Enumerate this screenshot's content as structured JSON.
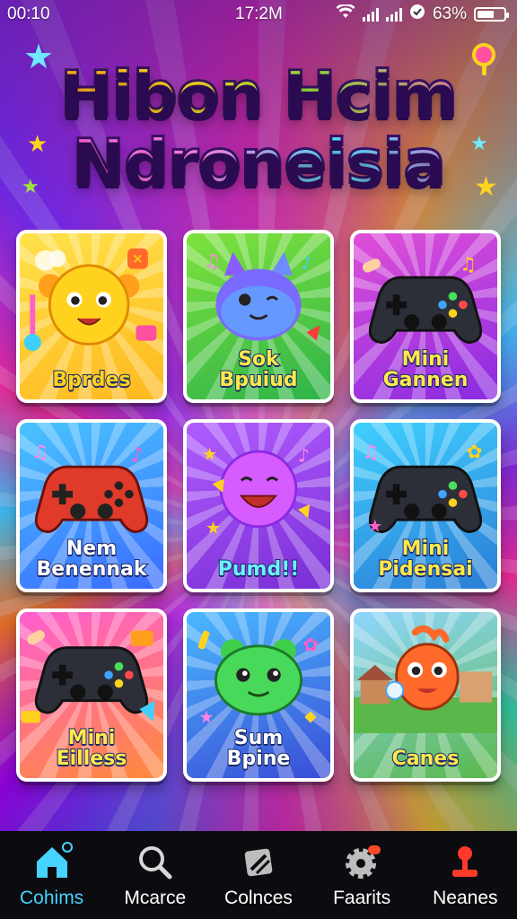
{
  "status_bar": {
    "time_left": "00:10",
    "time_center": "17:2M",
    "battery": "63%",
    "battery_level": 0.63
  },
  "title": {
    "line1": "Hibon Hcim",
    "line2": "Ndroneisia"
  },
  "games": [
    {
      "label_line1": "Bprdes",
      "label_line2": "",
      "art": "yellow-bear-character",
      "bg": [
        "#ffe24a",
        "#ffb81e"
      ],
      "label_color": "#ffd21e"
    },
    {
      "label_line1": "Sok",
      "label_line2": "Bpuiud",
      "art": "purple-cat-character",
      "bg": [
        "#7ee23c",
        "#2fb34a"
      ],
      "label_color": "#ffe94a"
    },
    {
      "label_line1": "Mini",
      "label_line2": "Gannen",
      "art": "gamepad-black",
      "bg": [
        "#e04fd8",
        "#8a2be2"
      ],
      "label_color": "#ffe94a"
    },
    {
      "label_line1": "Nem",
      "label_line2": "Benennak",
      "art": "gamepad-red",
      "bg": [
        "#49c4ff",
        "#3a6bff"
      ],
      "label_color": "#ffffff"
    },
    {
      "label_line1": "Pumd!!",
      "label_line2": "",
      "art": "purple-blob-character",
      "bg": [
        "#b05cff",
        "#7a2ed6"
      ],
      "label_color": "#6ff0ff"
    },
    {
      "label_line1": "Mini",
      "label_line2": "Pidensai",
      "art": "gamepad-black",
      "bg": [
        "#3fd0ff",
        "#2a7dd6"
      ],
      "label_color": "#ffe94a"
    },
    {
      "label_line1": "Mini",
      "label_line2": "Eilless",
      "art": "gamepad-black",
      "bg": [
        "#ff5ecf",
        "#ff8a3a"
      ],
      "label_color": "#ffe94a"
    },
    {
      "label_line1": "Sum",
      "label_line2": "Bpine",
      "art": "green-frog-character",
      "bg": [
        "#49b8ff",
        "#3a4dd6"
      ],
      "label_color": "#ffffff"
    },
    {
      "label_line1": "Canes",
      "label_line2": "",
      "art": "orange-fish-character",
      "bg": [
        "#8fd6ff",
        "#5ab84a"
      ],
      "label_color": "#ffe94a"
    }
  ],
  "nav": [
    {
      "label": "Cohims",
      "icon": "home-icon",
      "active": true
    },
    {
      "label": "Mcarce",
      "icon": "search-icon",
      "active": false
    },
    {
      "label": "Colnces",
      "icon": "tag-icon",
      "active": false
    },
    {
      "label": "Faarits",
      "icon": "gear-icon",
      "active": false
    },
    {
      "label": "Neanes",
      "icon": "joystick-icon",
      "active": false
    }
  ],
  "colors": {
    "accent": "#46d3ff",
    "nav_bg": "#0c0c10"
  }
}
